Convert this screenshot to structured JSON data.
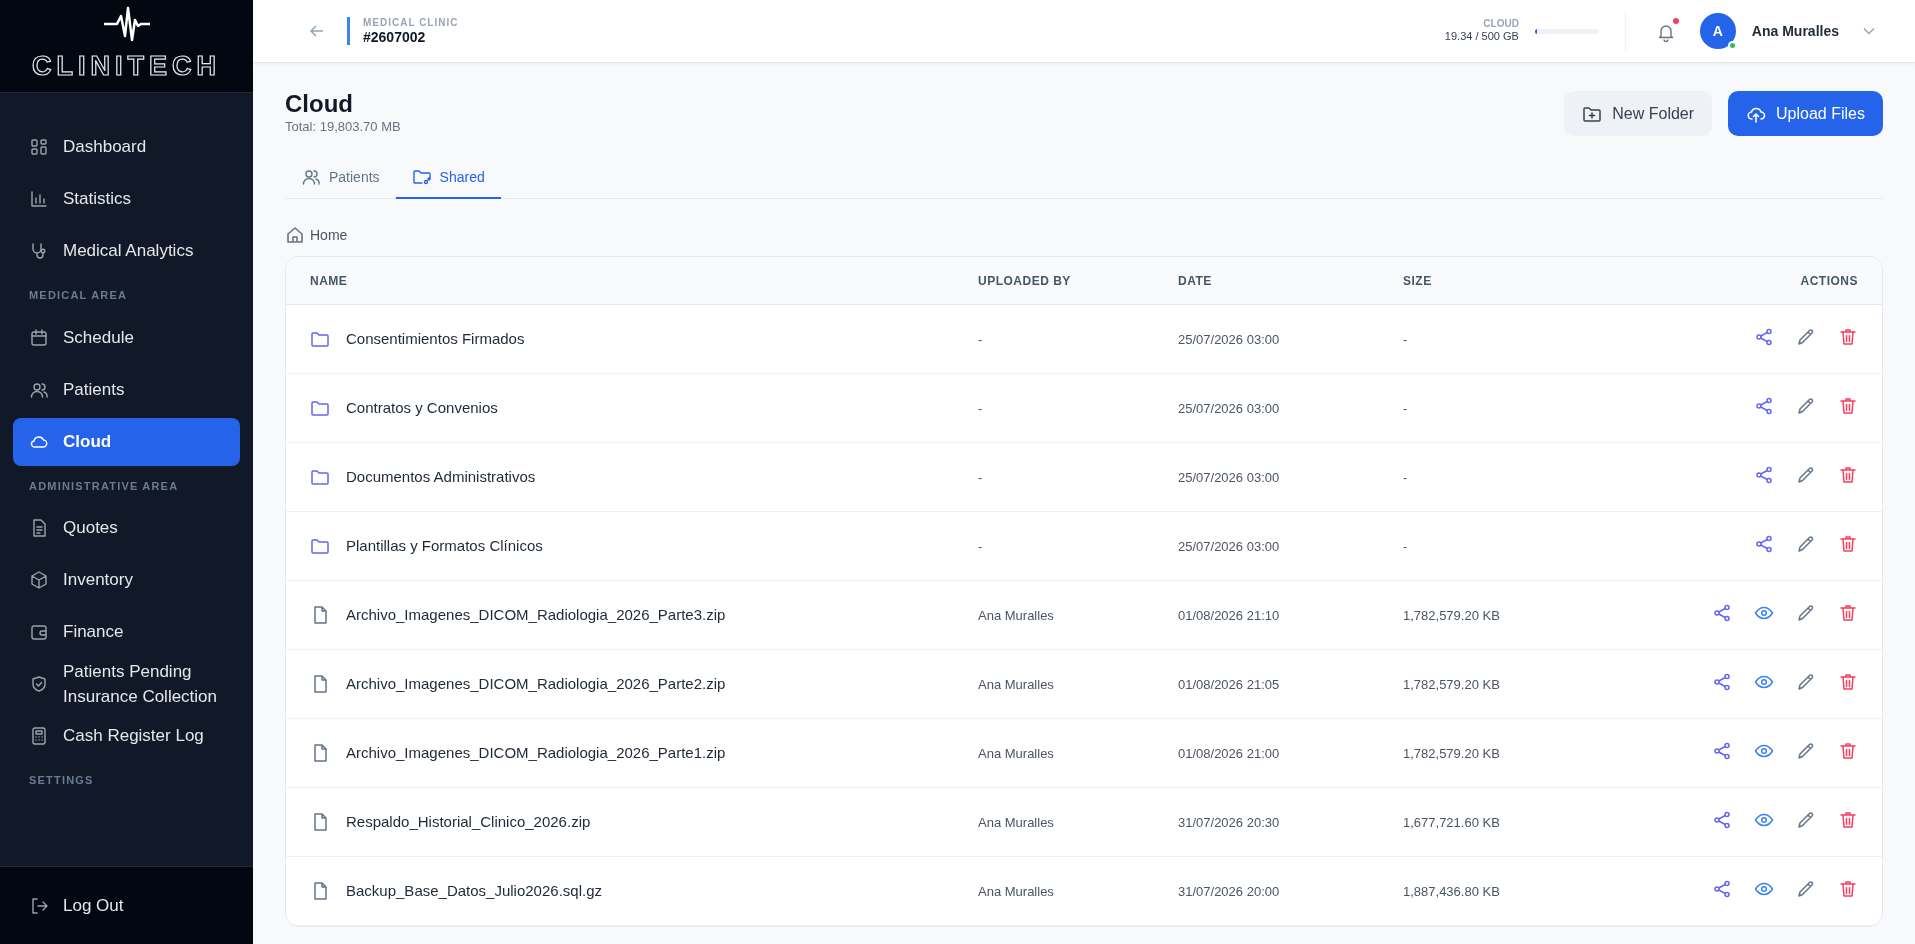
{
  "brand": {
    "name": "CLINITECH"
  },
  "sidebar": {
    "items": [
      {
        "kind": "item",
        "label": "Dashboard",
        "selected": false
      },
      {
        "kind": "item",
        "label": "Statistics",
        "selected": false
      },
      {
        "kind": "item",
        "label": "Medical Analytics",
        "selected": false
      },
      {
        "kind": "section",
        "label": "MEDICAL AREA"
      },
      {
        "kind": "item",
        "label": "Schedule",
        "selected": false
      },
      {
        "kind": "item",
        "label": "Patients",
        "selected": false
      },
      {
        "kind": "item",
        "label": "Cloud",
        "selected": true
      },
      {
        "kind": "section",
        "label": "ADMINISTRATIVE AREA"
      },
      {
        "kind": "item",
        "label": "Quotes",
        "selected": false
      },
      {
        "kind": "item",
        "label": "Inventory",
        "selected": false
      },
      {
        "kind": "item",
        "label": "Finance",
        "selected": false
      },
      {
        "kind": "item",
        "label": "Patients Pending Insurance Collection",
        "selected": false
      },
      {
        "kind": "item",
        "label": "Cash Register Log",
        "selected": false
      },
      {
        "kind": "section",
        "label": "SETTINGS"
      }
    ],
    "logout": "Log Out"
  },
  "header": {
    "context_label": "MEDICAL CLINIC",
    "context_value": "#2607002",
    "storage_label": "CLOUD",
    "storage_reading": "19.34 / 500 GB",
    "storage": {
      "level": 0.039
    },
    "notifications_unread": true,
    "user": {
      "initial": "A",
      "name": "Ana Muralles",
      "online": true
    }
  },
  "page": {
    "title": "Cloud",
    "subtitle": "Total: 19,803.70 MB",
    "buttons": [
      {
        "kind": "secondary",
        "label": "New Folder"
      },
      {
        "kind": "primary",
        "label": "Upload Files"
      }
    ]
  },
  "tabs": [
    {
      "label": "Patients",
      "selected": false
    },
    {
      "label": "Shared",
      "selected": true
    }
  ],
  "breadcrumb": [
    "Home"
  ],
  "table": {
    "columns": [
      "NAME",
      "UPLOADED BY",
      "DATE",
      "SIZE",
      "ACTIONS"
    ],
    "rows": [
      {
        "kind": "folder",
        "name": "Consentimientos Firmados",
        "uploaded_by": "-",
        "date": "25/07/2026 03:00",
        "size": "-"
      },
      {
        "kind": "folder",
        "name": "Contratos y Convenios",
        "uploaded_by": "-",
        "date": "25/07/2026 03:00",
        "size": "-"
      },
      {
        "kind": "folder",
        "name": "Documentos Administrativos",
        "uploaded_by": "-",
        "date": "25/07/2026 03:00",
        "size": "-"
      },
      {
        "kind": "folder",
        "name": "Plantillas y Formatos Clínicos",
        "uploaded_by": "-",
        "date": "25/07/2026 03:00",
        "size": "-"
      },
      {
        "kind": "file",
        "name": "Archivo_Imagenes_DICOM_Radiologia_2026_Parte3.zip",
        "uploaded_by": "Ana Muralles",
        "date": "01/08/2026 21:10",
        "size": "1,782,579.20 KB"
      },
      {
        "kind": "file",
        "name": "Archivo_Imagenes_DICOM_Radiologia_2026_Parte2.zip",
        "uploaded_by": "Ana Muralles",
        "date": "01/08/2026 21:05",
        "size": "1,782,579.20 KB"
      },
      {
        "kind": "file",
        "name": "Archivo_Imagenes_DICOM_Radiologia_2026_Parte1.zip",
        "uploaded_by": "Ana Muralles",
        "date": "01/08/2026 21:00",
        "size": "1,782,579.20 KB"
      },
      {
        "kind": "file",
        "name": "Respaldo_Historial_Clinico_2026.zip",
        "uploaded_by": "Ana Muralles",
        "date": "31/07/2026 20:30",
        "size": "1,677,721.60 KB"
      },
      {
        "kind": "file",
        "name": "Backup_Base_Datos_Julio2026.sql.gz",
        "uploaded_by": "Ana Muralles",
        "date": "31/07/2026 20:00",
        "size": "1,887,436.80 KB"
      }
    ]
  }
}
